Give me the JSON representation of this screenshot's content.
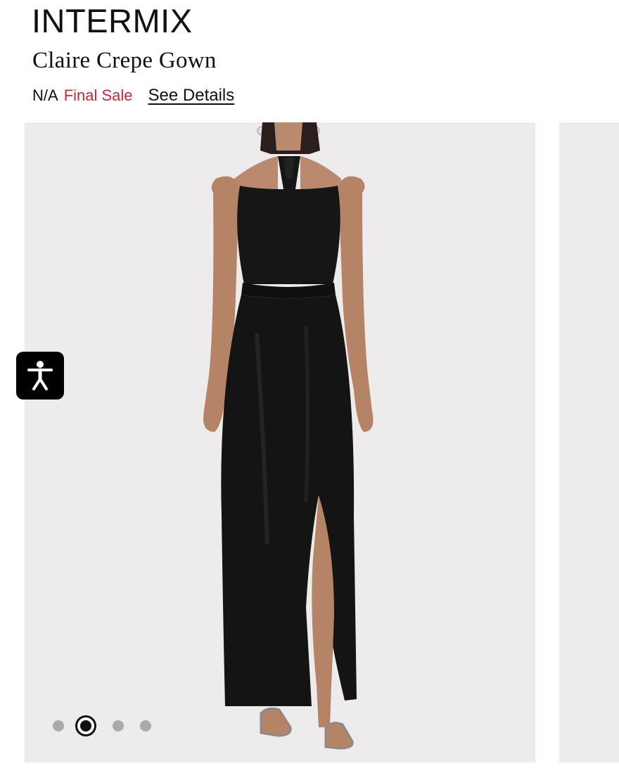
{
  "product": {
    "brand": "INTERMIX",
    "name": "Claire Crepe Gown",
    "price": "N/A",
    "sale_label": "Final Sale",
    "details_link": "See Details"
  },
  "gallery": {
    "total_images": 4,
    "active_index": 2,
    "image_alt": "Model wearing black halter gown with side slit"
  },
  "icons": {
    "accessibility": "accessibility-person-icon"
  },
  "colors": {
    "sale_red": "#c8283c",
    "gallery_bg": "#eeebed",
    "text": "#111111"
  }
}
